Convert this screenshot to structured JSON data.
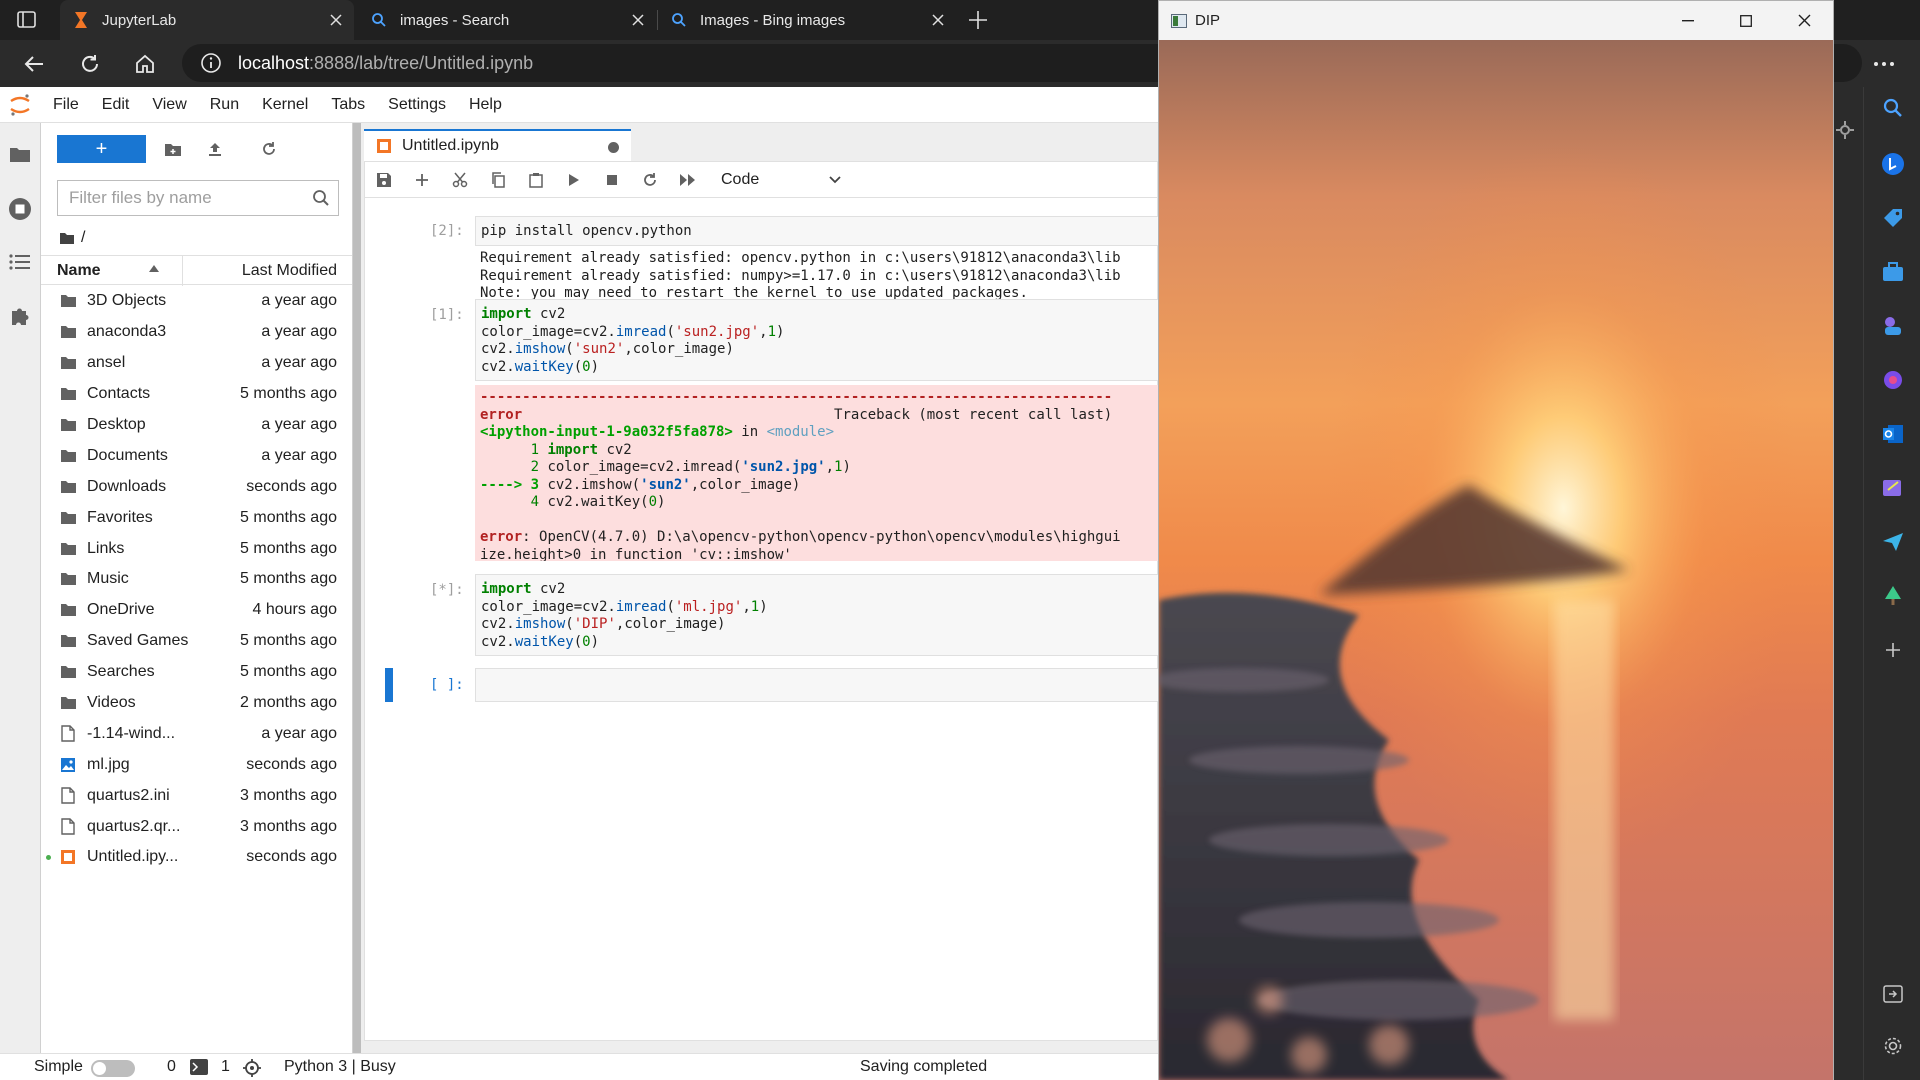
{
  "browser": {
    "tabs": [
      {
        "title": "JupyterLab",
        "icon": "jupyter-icon",
        "active": true
      },
      {
        "title": "images - Search",
        "icon": "search-icon",
        "active": false
      },
      {
        "title": "Images - Bing images",
        "icon": "search-icon",
        "active": false
      }
    ],
    "url_host": "localhost",
    "url_path": ":8888/lab/tree/Untitled.ipynb"
  },
  "jupyter": {
    "menu": [
      "File",
      "Edit",
      "View",
      "Run",
      "Kernel",
      "Tabs",
      "Settings",
      "Help"
    ],
    "new_button": "+",
    "filter_placeholder": "Filter files by name",
    "breadcrumb": "/",
    "columns": {
      "name": "Name",
      "modified": "Last Modified"
    },
    "files": [
      {
        "name": "3D Objects",
        "modified": "a year ago",
        "type": "folder"
      },
      {
        "name": "anaconda3",
        "modified": "a year ago",
        "type": "folder"
      },
      {
        "name": "ansel",
        "modified": "a year ago",
        "type": "folder"
      },
      {
        "name": "Contacts",
        "modified": "5 months ago",
        "type": "folder"
      },
      {
        "name": "Desktop",
        "modified": "a year ago",
        "type": "folder"
      },
      {
        "name": "Documents",
        "modified": "a year ago",
        "type": "folder"
      },
      {
        "name": "Downloads",
        "modified": "seconds ago",
        "type": "folder"
      },
      {
        "name": "Favorites",
        "modified": "5 months ago",
        "type": "folder"
      },
      {
        "name": "Links",
        "modified": "5 months ago",
        "type": "folder"
      },
      {
        "name": "Music",
        "modified": "5 months ago",
        "type": "folder"
      },
      {
        "name": "OneDrive",
        "modified": "4 hours ago",
        "type": "folder"
      },
      {
        "name": "Saved Games",
        "modified": "5 months ago",
        "type": "folder"
      },
      {
        "name": "Searches",
        "modified": "5 months ago",
        "type": "folder"
      },
      {
        "name": "Videos",
        "modified": "2 months ago",
        "type": "folder"
      },
      {
        "name": "-1.14-wind...",
        "modified": "a year ago",
        "type": "file"
      },
      {
        "name": "ml.jpg",
        "modified": "seconds ago",
        "type": "image"
      },
      {
        "name": "quartus2.ini",
        "modified": "3 months ago",
        "type": "file"
      },
      {
        "name": "quartus2.qr...",
        "modified": "3 months ago",
        "type": "file"
      },
      {
        "name": "Untitled.ipy...",
        "modified": "seconds ago",
        "type": "notebook"
      }
    ],
    "notebook_tab": "Untitled.ipynb",
    "cell_type": "Code",
    "cells": {
      "c1_prompt": "[2]:",
      "c1_code": "pip install opencv.python",
      "c1_out1": "Requirement already satisfied: opencv.python in c:\\users\\91812\\anaconda3\\lib",
      "c1_out2": "Requirement already satisfied: numpy>=1.17.0 in c:\\users\\91812\\anaconda3\\lib",
      "c1_out3": "Note: you may need to restart the kernel to use updated packages.",
      "c2_prompt": "[1]:",
      "c2_l1_kw": "import",
      "c2_l1_rest": " cv2",
      "c2_l2_a": "color_image=cv2.",
      "c2_l2_fn": "imread",
      "c2_l2_str": "'sun2.jpg'",
      "c2_l2_num": "1",
      "c2_l3_a": "cv2.",
      "c2_l3_fn": "imshow",
      "c2_l3_str": "'sun2'",
      "c2_l3_b": ",color_image)",
      "c2_l4_a": "cv2.",
      "c2_l4_fn": "waitKey",
      "c2_l4_num": "0",
      "err_dashes": "---------------------------------------------------------------------------",
      "err_name": "error",
      "err_traceback": "Traceback (most recent call last)",
      "err_loc": "<ipython-input-1-9a032f5fa878>",
      "err_in": " in ",
      "err_module": "<module>",
      "err_l1_num": "      1 ",
      "err_l1_kw": "import",
      "err_l1_rest": " cv2",
      "err_l2_num": "      2 ",
      "err_l2_a": "color_image=cv2.imread(",
      "err_l2_str": "'sun2.jpg'",
      "err_l2_b": ",",
      "err_l2_n": "1",
      "err_l2_c": ")",
      "err_arrow": "----> 3 ",
      "err_l3_a": "cv2.imshow(",
      "err_l3_str": "'sun2'",
      "err_l3_b": ",color_image)",
      "err_l4_num": "      4 ",
      "err_l4_a": "cv2.waitKey(",
      "err_l4_n": "0",
      "err_l4_b": ")",
      "err_msg_name": "error",
      "err_msg1": ": OpenCV(4.7.0) D:\\a\\opencv-python\\opencv-python\\opencv\\modules\\highgui",
      "err_msg2": "ize.height>0 in function 'cv::imshow'",
      "c3_prompt": "[*]:",
      "c3_l1_kw": "import",
      "c3_l1_rest": " cv2",
      "c3_l2_a": "color_image=cv2.",
      "c3_l2_fn": "imread",
      "c3_l2_str": "'ml.jpg'",
      "c3_l2_num": "1",
      "c3_l3_a": "cv2.",
      "c3_l3_fn": "imshow",
      "c3_l3_str": "'DIP'",
      "c3_l3_b": ",color_image)",
      "c3_l4_a": "cv2.",
      "c3_l4_fn": "waitKey",
      "c3_l4_num": "0",
      "c4_prompt": "[ ]:"
    },
    "status": {
      "mode": "Simple",
      "terminals": "0",
      "kernels": "1",
      "kernel": "Python 3 | Busy",
      "message": "Saving completed"
    }
  },
  "dip_window": {
    "title": "DIP"
  },
  "colors": {
    "jupyter_blue": "#1976d2",
    "error_bg": "#fddede",
    "browser_dark": "#202020"
  }
}
